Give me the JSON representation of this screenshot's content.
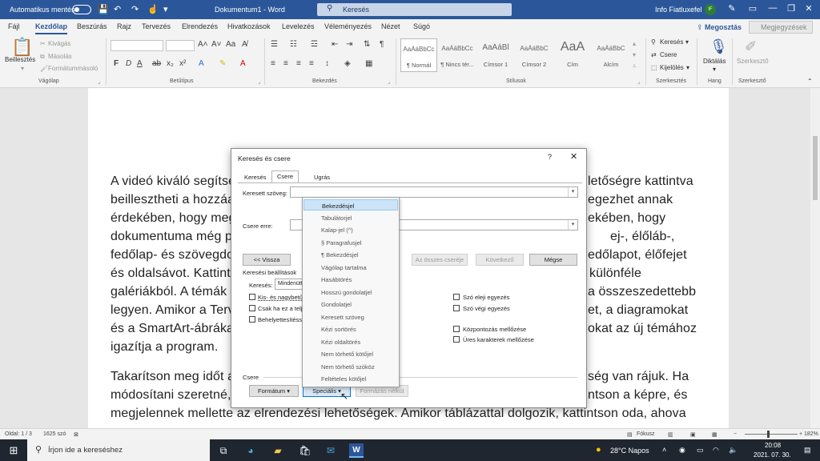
{
  "titlebar": {
    "autosave_label": "Automatikus mentés",
    "document_title": "Dokumentum1 - Word",
    "search_placeholder": "Keresés",
    "user_name": "Info Fiatluxefel",
    "user_initials": "IF"
  },
  "tabs": [
    "Fájl",
    "Kezdőlap",
    "Beszúrás",
    "Rajz",
    "Tervezés",
    "Elrendezés",
    "Hivatkozások",
    "Levelezés",
    "Véleményezés",
    "Nézet",
    "Súgó"
  ],
  "active_tab": "Kezdőlap",
  "ribbon_actions": {
    "share": "Megosztás",
    "comments": "Megjegyzések"
  },
  "ribbon": {
    "clipboard": {
      "paste": "Beillesztés",
      "cut": "Kivágás",
      "copy": "Másolás",
      "format_painter": "Formátummásoló",
      "label": "Vágólap"
    },
    "font": {
      "label": "Betűtípus"
    },
    "paragraph": {
      "label": "Bekezdés"
    },
    "styles": {
      "label": "Stílusok",
      "items": [
        {
          "preview": "AaÁáBbCc",
          "name": "¶ Normál"
        },
        {
          "preview": "AaÁáBbCc",
          "name": "¶ Nincs tér..."
        },
        {
          "preview": "AaÁáBl",
          "name": "Címsor 1"
        },
        {
          "preview": "AaÁáBbC",
          "name": "Címsor 2"
        },
        {
          "preview": "AaA",
          "name": "Cím"
        },
        {
          "preview": "AaÁáBbC",
          "name": "Alcím"
        }
      ]
    },
    "editing": {
      "find": "Keresés",
      "replace": "Csere",
      "select": "Kijelölés",
      "label": "Szerkesztés"
    },
    "voice": {
      "dictate": "Diktálás",
      "label": "Hang"
    },
    "editor": {
      "name": "Szerkesztő",
      "label": "Szerkesztő"
    }
  },
  "document": {
    "lines_left": [
      "A videó kiváló segítsé",
      "beillesztheti a hozzáa",
      "érdekében, hogy meg",
      "dokumentuma még p",
      "fedőlap- és szövegdo",
      "és oldalsávot. Kattint",
      "galériákból. A témák",
      "legyen. Amikor a Terv",
      "és a SmartArt-ábráka",
      "igazítja a program."
    ],
    "lines_right": [
      "letőségre kattintva",
      "egezhet annak",
      "ekében, hogy",
      "ej-, élőláb-,",
      "edőlapot, élőfejet",
      "különféle",
      "a összeszedettebb",
      "et, a diagramokat",
      "okat az új témához"
    ],
    "para2_line1_left": "Takarítson meg időt a",
    "para2_line1_right": "ség van rájuk. Ha",
    "para2_line2_left": "módosítani szeretné,",
    "para2_line2_right": "ntson a képre, és",
    "para2_line3": "megjelennek mellette az elrendezési lehetőségek. Amikor táblázattal dolgozik, kattintson oda, ahova"
  },
  "dialog": {
    "title": "Keresés és csere",
    "help": "?",
    "tabs": [
      "Keresés",
      "Csere",
      "Ugrás"
    ],
    "active_tab": "Csere",
    "find_label": "Keresett szöveg:",
    "replace_label": "Csere erre:",
    "buttons": {
      "less": "<< Vissza",
      "replace_all": "Az összes cseréje",
      "find_next": "Következő",
      "cancel": "Mégse",
      "format": "Formátum ▾",
      "special": "Speciális ▾",
      "no_format": "Formázás nélkül"
    },
    "search_options_label": "Keresési beállítások",
    "search_label": "Keresés:",
    "search_value": "Mindenütt",
    "options_left": [
      "Kis- és nagybetűk",
      "Csak ha ez a teljes",
      "Behelyettesítéssel"
    ],
    "options_right_top": [
      "Szó eleji egyezés",
      "Szó végi egyezés"
    ],
    "options_right_bottom": [
      "Központozás mellőzése",
      "Üres karakterek mellőzése"
    ],
    "replace_section_label": "Csere"
  },
  "special_menu": {
    "items": [
      "Bekezdésjel",
      "Tabulátorjel",
      "Kalap-jel (^)",
      "§ Paragrafusjel",
      "¶ Bekezdésjel",
      "Vágólap tartalma",
      "Hasábtörés",
      "Hosszú gondolatjel",
      "Gondolatjel",
      "Keresett szöveg",
      "Kézi sortörés",
      "Kézi oldaltörés",
      "Nem törhető kötőjel",
      "Nem törhető szóköz",
      "Feltételes kötőjel"
    ],
    "highlighted_index": 0
  },
  "statusbar": {
    "page": "Oldal: 1 / 3",
    "words": "1625 szó",
    "focus": "Fókusz",
    "zoom": "182%"
  },
  "taskbar": {
    "search_placeholder": "Írjon ide a kereséshez",
    "weather": "28°C  Napos",
    "time": "20:08",
    "date": "2021. 07. 30."
  }
}
